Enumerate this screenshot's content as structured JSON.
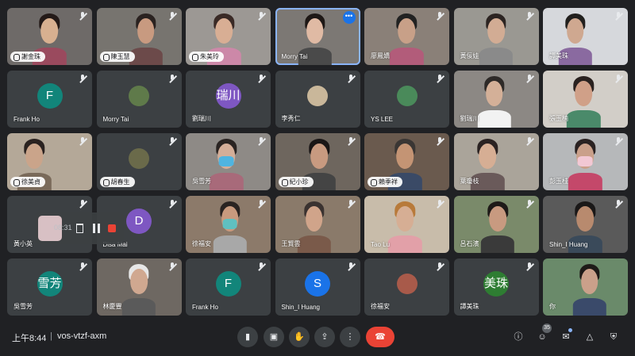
{
  "tiles": [
    {
      "name": "謝金珠",
      "style": "pill",
      "muted": true,
      "kind": "video",
      "bg": "#6e6a68",
      "person": {
        "x": 50,
        "skin": "#d8b090",
        "hair": "#241a18",
        "shirt": "#9a4a5e"
      }
    },
    {
      "name": "陳玉慧",
      "style": "pill",
      "muted": true,
      "kind": "video",
      "bg": "#77746f",
      "person": {
        "x": 58,
        "skin": "#c89a80",
        "hair": "#2a2220",
        "shirt": "#6c4a4a"
      }
    },
    {
      "name": "朱美玲",
      "style": "pill",
      "muted": true,
      "kind": "video",
      "bg": "#9c9894",
      "person": {
        "x": 45,
        "skin": "#d8ae94",
        "hair": "#3a2a26",
        "shirt": "#cc88a8"
      }
    },
    {
      "name": "Morry Tai",
      "style": "plain",
      "muted": false,
      "active": true,
      "kind": "video",
      "bg": "#7c7874",
      "person": {
        "x": 47,
        "skin": "#e0baa4",
        "hair": "#1e1816",
        "shirt": "#4a4a4a"
      }
    },
    {
      "name": "廖鳳嬌",
      "style": "plain",
      "muted": true,
      "kind": "video",
      "bg": "#8a8078",
      "person": {
        "x": 50,
        "skin": "#c8a088",
        "hair": "#222222",
        "shirt": "#b25c7a"
      }
    },
    {
      "name": "黃佞娃",
      "style": "plain",
      "muted": true,
      "kind": "video",
      "bg": "#9a9892",
      "person": {
        "x": 50,
        "skin": "#d2ac94",
        "hair": "#2c2422",
        "shirt": "#8a8a8a"
      }
    },
    {
      "name": "譚美珠",
      "style": "plain",
      "muted": true,
      "kind": "video",
      "bg": "#d6d8dc",
      "person": {
        "x": 38,
        "skin": "#cfa890",
        "hair": "#22201e",
        "shirt": "#8a6aa0"
      }
    },
    {
      "name": "Frank Ho",
      "style": "plain",
      "muted": true,
      "kind": "avatar",
      "avatar": "F",
      "avatar_color": "#12857a"
    },
    {
      "name": "Morry Tai",
      "style": "plain",
      "muted": true,
      "kind": "avatar",
      "avatar": "",
      "avatar_color": "#5f7a4a"
    },
    {
      "name": "劉瑞川",
      "style": "plain",
      "muted": true,
      "kind": "avatar",
      "avatar": "瑞川",
      "avatar_color": "#7e57c2"
    },
    {
      "name": "李秀仁",
      "style": "plain",
      "muted": true,
      "kind": "avatar",
      "avatar": "",
      "avatar_color": "#c9b79a"
    },
    {
      "name": "YS LEE",
      "style": "plain",
      "muted": true,
      "kind": "avatar",
      "avatar": "",
      "avatar_color": "#4a8a5a"
    },
    {
      "name": "劉瑞川",
      "style": "plain",
      "muted": true,
      "kind": "video",
      "bg": "#8c8884",
      "person": {
        "x": 48,
        "skin": "#d4b098",
        "hair": "#2e2a28",
        "shirt": "#f2f2f2"
      }
    },
    {
      "name": "張玉楠",
      "style": "plain",
      "muted": true,
      "kind": "video",
      "bg": "#d2cec8",
      "person": {
        "x": 48,
        "skin": "#d0a088",
        "hair": "#2a2220",
        "shirt": "#4a8a6a"
      }
    },
    {
      "name": "徐美貞",
      "style": "pill",
      "muted": true,
      "kind": "video",
      "bg": "#b4a898",
      "person": {
        "x": 32,
        "skin": "#caa48a",
        "hair": "#2a2220",
        "shirt": "#7a6a5a"
      }
    },
    {
      "name": "胡春生",
      "style": "pill",
      "muted": true,
      "kind": "avatar",
      "avatar": "",
      "avatar_color": "#6a6a4a"
    },
    {
      "name": "吳雪芳",
      "style": "plain",
      "muted": true,
      "kind": "video",
      "bg": "#8e8a86",
      "person": {
        "x": 48,
        "skin": "#d4ae98",
        "hair": "#2a2422",
        "shirt": "#a86a7a",
        "mask": "#4fb4e0"
      }
    },
    {
      "name": "紀小珍",
      "style": "pill",
      "muted": true,
      "kind": "video",
      "bg": "#6e665e",
      "person": {
        "x": 52,
        "skin": "#c89a80",
        "hair": "#1a1616",
        "shirt": "#444444"
      }
    },
    {
      "name": "賴季祥",
      "style": "pill",
      "muted": true,
      "kind": "video",
      "bg": "#6a5a4e",
      "person": {
        "x": 48,
        "skin": "#c49474",
        "hair": "#3a3634",
        "shirt": "#3a4a66"
      }
    },
    {
      "name": "葉瓊枝",
      "style": "plain",
      "muted": true,
      "kind": "video",
      "bg": "#aaa49a",
      "person": {
        "x": 40,
        "skin": "#d6ae94",
        "hair": "#2a2222",
        "shirt": "#6a5a5a"
      }
    },
    {
      "name": "彭玉桂",
      "style": "plain",
      "muted": true,
      "kind": "video",
      "bg": "#b6b8ba",
      "person": {
        "x": 50,
        "skin": "#caa08a",
        "hair": "#2a2222",
        "shirt": "#c4486a",
        "mask": "#f2c8d4"
      }
    },
    {
      "name": "黃小英",
      "style": "plain",
      "muted": true,
      "kind": "empty"
    },
    {
      "name": "Disa Mai",
      "style": "plain",
      "muted": true,
      "kind": "avatar",
      "avatar": "D",
      "avatar_color": "#7e57c2"
    },
    {
      "name": "徐福安",
      "style": "plain",
      "muted": true,
      "kind": "video",
      "bg": "#8c7a6a",
      "person": {
        "x": 52,
        "skin": "#c89a7e",
        "hair": "#2a2422",
        "shirt": "#a8a8a8",
        "mask": "#5fc0c0"
      }
    },
    {
      "name": "王賢雲",
      "style": "plain",
      "muted": true,
      "kind": "video",
      "bg": "#8a7a6a",
      "person": {
        "x": 46,
        "skin": "#d0a48a",
        "hair": "#3a3230",
        "shirt": "#7a5a4a"
      }
    },
    {
      "name": "Tao Lu",
      "style": "plain",
      "muted": true,
      "kind": "video",
      "bg": "#c8bcaa",
      "person": {
        "x": 48,
        "skin": "#d6ae94",
        "hair": "#b87a3a",
        "shirt": "#e2a0a8"
      }
    },
    {
      "name": "呂石濱",
      "style": "plain",
      "muted": true,
      "kind": "video",
      "bg": "#7a8a6a",
      "person": {
        "x": 52,
        "skin": "#c89a80",
        "hair": "#1e1a18",
        "shirt": "#3a3a3a"
      }
    },
    {
      "name": "Shin_I Huang",
      "style": "plain",
      "muted": true,
      "kind": "video",
      "bg": "#5a5a5a",
      "person": {
        "x": 50,
        "skin": "#b88a6e",
        "hair": "#1a1818",
        "shirt": "#3a4a5a"
      }
    },
    {
      "name": "吳雪芳",
      "style": "plain",
      "muted": true,
      "kind": "avatar",
      "avatar": "雪芳",
      "avatar_color": "#12857a"
    },
    {
      "name": "林慶豐",
      "style": "plain",
      "muted": true,
      "kind": "video",
      "bg": "#6e6862",
      "person": {
        "x": 50,
        "skin": "#d0a890",
        "hair": "#e6e6e6",
        "shirt": "#5a5a5a"
      }
    },
    {
      "name": "Frank Ho",
      "style": "plain",
      "muted": true,
      "kind": "avatar",
      "avatar": "F",
      "avatar_color": "#12857a"
    },
    {
      "name": "Shin_I Huang",
      "style": "plain",
      "muted": true,
      "kind": "avatar",
      "avatar": "S",
      "avatar_color": "#1a73e8"
    },
    {
      "name": "徐福安",
      "style": "plain",
      "muted": true,
      "kind": "avatar",
      "avatar": "",
      "avatar_color": "#a85a4a"
    },
    {
      "name": "譚美珠",
      "style": "plain",
      "muted": true,
      "kind": "avatar",
      "avatar": "美珠",
      "avatar_color": "#2e7d32"
    },
    {
      "name": "你",
      "style": "plain",
      "muted": false,
      "kind": "video",
      "bg": "#6a8a6a",
      "person": {
        "x": 55,
        "skin": "#caa08a",
        "hair": "#1e1a18",
        "shirt": "#3a4a6a"
      }
    }
  ],
  "self_bar": {
    "time": "08:31"
  },
  "toolbar": {
    "time": "上午8:44",
    "separator": "|",
    "meeting_code": "vos-vtzf-axm",
    "people_count": "35",
    "icons": [
      "mic-icon",
      "camera-icon",
      "raise-hand-icon",
      "present-icon",
      "more-icon",
      "hang-up-icon",
      "info-icon",
      "people-icon",
      "chat-icon",
      "activities-icon",
      "host-controls-icon"
    ],
    "glyphs": {
      "mic": "▮",
      "camera": "▣",
      "hand": "✋",
      "present": "⇪",
      "more": "⋮",
      "hangup": "☎",
      "info": "ⓘ",
      "people": "☺",
      "chat": "✉",
      "activities": "△",
      "lock": "⛨"
    }
  }
}
